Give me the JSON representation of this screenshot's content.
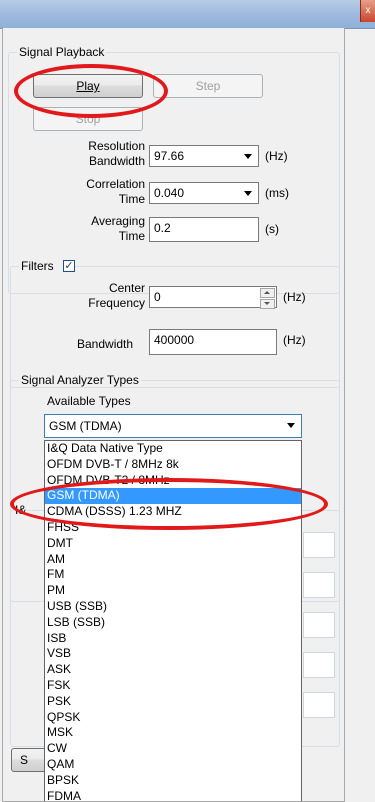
{
  "window": {
    "close_glyph": "x"
  },
  "playback": {
    "group_title": "Signal Playback",
    "play_label": "Play",
    "step_label": "Step",
    "stop_label": "Stop",
    "resolution_label_line1": "Resolution",
    "resolution_label_line2": "Bandwidth",
    "resolution_value": "97.66",
    "resolution_unit": "(Hz)",
    "correlation_label_line1": "Correlation",
    "correlation_label_line2": "Time",
    "correlation_value": "0.040",
    "correlation_unit": "(ms)",
    "averaging_label_line1": "Averaging",
    "averaging_label_line2": "Time",
    "averaging_value": "0.2",
    "averaging_unit": "(s)"
  },
  "filters": {
    "group_title": "Filters",
    "checkbox_checked": true,
    "check_glyph": "✓",
    "center_label_line1": "Center",
    "center_label_line2": "Frequency",
    "center_value": "0",
    "center_unit": "(Hz)",
    "bandwidth_label": "Bandwidth",
    "bandwidth_value": "400000",
    "bandwidth_unit": "(Hz)"
  },
  "analyzer": {
    "group_title": "Signal Analyzer Types",
    "available_label": "Available Types",
    "selected": "GSM (TDMA)",
    "hidden_group_prefix": "I&",
    "bottom_button_prefix": "S",
    "items": [
      "I&Q Data Native Type",
      "OFDM DVB-T / 8MHz 8k",
      "OFDM DVB-T2 / 8MHz",
      "GSM (TDMA)",
      "CDMA (DSSS) 1.23 MHZ",
      "FHSS",
      "DMT",
      "AM",
      "FM",
      "PM",
      "USB (SSB)",
      "LSB (SSB)",
      "ISB",
      "VSB",
      "ASK",
      "FSK",
      "PSK",
      "QPSK",
      "MSK",
      "CW",
      "QAM",
      "BPSK",
      "FDMA"
    ]
  },
  "colors": {
    "highlight": "#3399ff",
    "annotation": "#e2191b"
  }
}
